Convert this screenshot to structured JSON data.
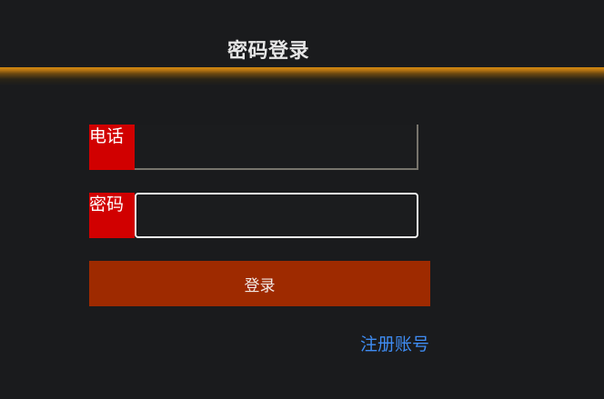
{
  "header": {
    "title": "密码登录"
  },
  "form": {
    "phone_label": "电话",
    "phone_value": "",
    "password_label": "密码",
    "password_value": "",
    "login_label": "登录",
    "register_label": "注册账号"
  },
  "colors": {
    "background": "#1a1b1d",
    "label_bg": "#d10000",
    "button_bg": "#9e2a00",
    "accent_line": "#d58a10",
    "link": "#3f8cf2"
  }
}
